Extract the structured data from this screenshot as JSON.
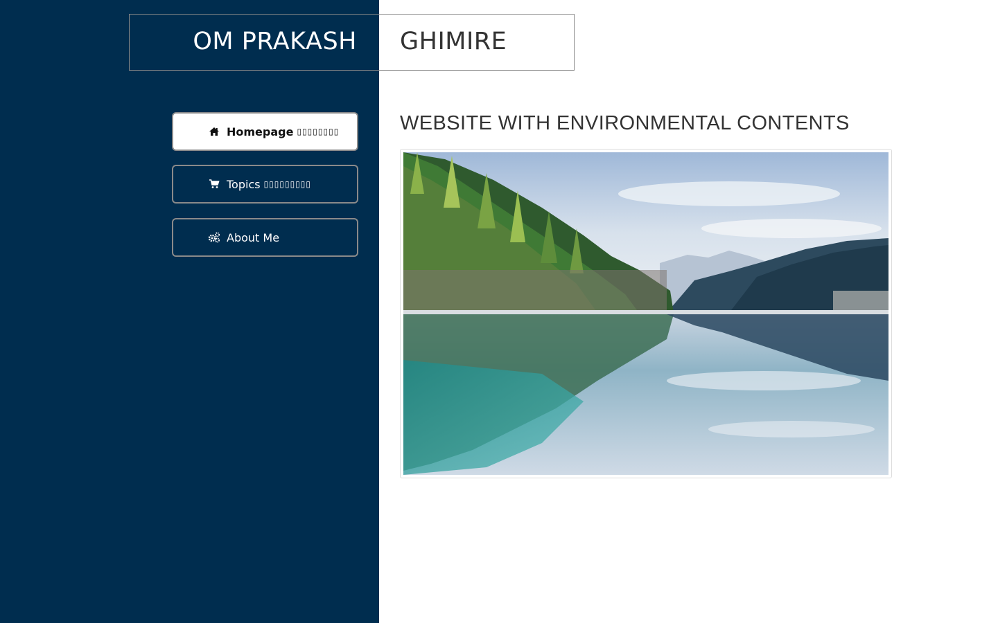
{
  "header": {
    "first_name": "OM PRAKASH",
    "last_name": "GHIMIRE"
  },
  "sidebar": {
    "items": [
      {
        "label": "Homepage",
        "suffix": "▯▯▯▯▯▯▯▯",
        "icon": "home-icon",
        "active": true
      },
      {
        "label": "Topics",
        "suffix": "▯▯▯▯▯▯▯▯▯",
        "icon": "cart-icon",
        "active": false
      },
      {
        "label": "About Me",
        "suffix": "",
        "icon": "gears-icon",
        "active": false
      }
    ]
  },
  "main": {
    "heading": "WEBSITE WITH ENVIRONMENTAL CONTENTS",
    "image": "lake-forest-reflection-image"
  },
  "colors": {
    "sidebar_bg": "#002d4f",
    "heading_text": "#333333",
    "button_border": "#8a8a8a"
  }
}
